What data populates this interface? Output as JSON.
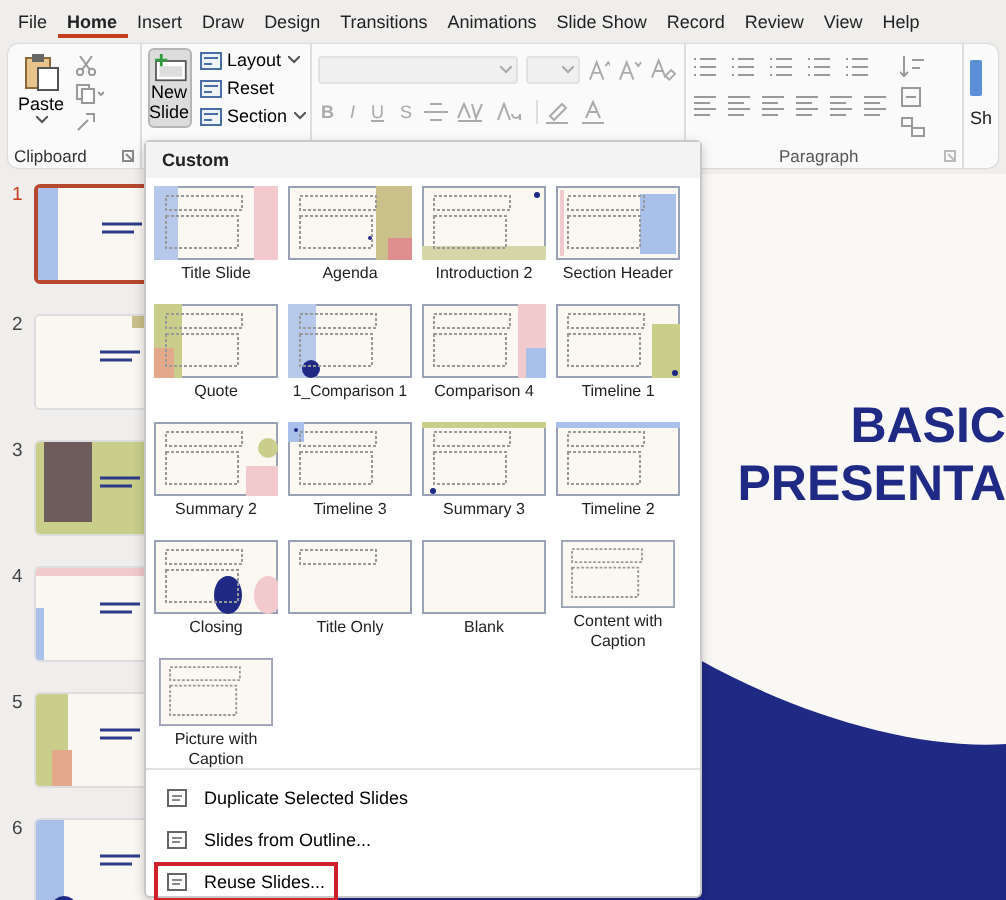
{
  "tabs": [
    {
      "label": "File",
      "selected": false
    },
    {
      "label": "Home",
      "selected": true
    },
    {
      "label": "Insert",
      "selected": false
    },
    {
      "label": "Draw",
      "selected": false
    },
    {
      "label": "Design",
      "selected": false
    },
    {
      "label": "Transitions",
      "selected": false
    },
    {
      "label": "Animations",
      "selected": false
    },
    {
      "label": "Slide Show",
      "selected": false
    },
    {
      "label": "Record",
      "selected": false
    },
    {
      "label": "Review",
      "selected": false
    },
    {
      "label": "View",
      "selected": false
    },
    {
      "label": "Help",
      "selected": false
    }
  ],
  "ribbon": {
    "clipboard": {
      "paste": "Paste",
      "label": "Clipboard"
    },
    "slides": {
      "new_slide": {
        "label": "New Slide",
        "open": true
      },
      "buttons": [
        "Layout",
        "Reset",
        "Section"
      ]
    },
    "font": {
      "disabled": true,
      "buttons": [
        "B",
        "I",
        "U",
        "S"
      ]
    },
    "paragraph": {
      "label": "Paragraph"
    },
    "next_group_label": "Sh"
  },
  "slides": [
    {
      "number": "1",
      "selected": true
    },
    {
      "number": "2",
      "selected": false
    },
    {
      "number": "3",
      "selected": false
    },
    {
      "number": "4",
      "selected": false
    },
    {
      "number": "5",
      "selected": false
    },
    {
      "number": "6",
      "selected": false
    }
  ],
  "slide": {
    "title_lines": [
      "BASIC",
      "PRESENTA"
    ]
  },
  "new_slide_menu": {
    "heading": "Custom",
    "layouts": [
      "Title Slide",
      "Agenda",
      "Introduction 2",
      "Section Header",
      "Quote",
      "1_Comparison 1",
      "Comparison 4",
      "Timeline 1",
      "Summary 2",
      "Timeline 3",
      "Summary 3",
      "Timeline 2",
      "Closing",
      "Title Only",
      "Blank",
      "Content with Caption",
      "Picture with Caption"
    ],
    "commands": [
      {
        "label": "Duplicate Selected Slides",
        "highlighted": false
      },
      {
        "label": "Slides from Outline...",
        "highlighted": false
      },
      {
        "label": "Reuse Slides...",
        "highlighted": true
      }
    ]
  }
}
